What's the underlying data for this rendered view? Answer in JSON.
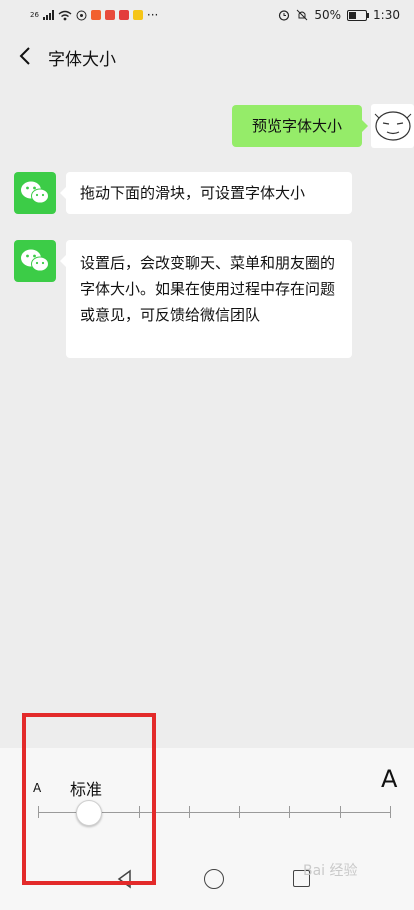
{
  "status_bar": {
    "network": "26",
    "more": "···",
    "battery": "50%",
    "time": "1:30"
  },
  "header": {
    "title": "字体大小",
    "back_icon": "chevron-left-icon"
  },
  "chat": {
    "user_message": "预览字体大小",
    "bot_messages": [
      "拖动下面的滑块，可设置字体大小",
      "设置后，会改变聊天、菜单和朋友圈的字体大小。如果在使用过程中存在问题或意见，可反馈给微信团队"
    ]
  },
  "font_size": {
    "small_label": "A",
    "large_label": "A",
    "current_label": "标准",
    "levels": 8,
    "selected_index": 1
  },
  "watermark": "Bai 经验",
  "colors": {
    "bubble_user": "#95ec69",
    "wechat_green": "#3ccc47",
    "highlight": "#e32a2a"
  }
}
